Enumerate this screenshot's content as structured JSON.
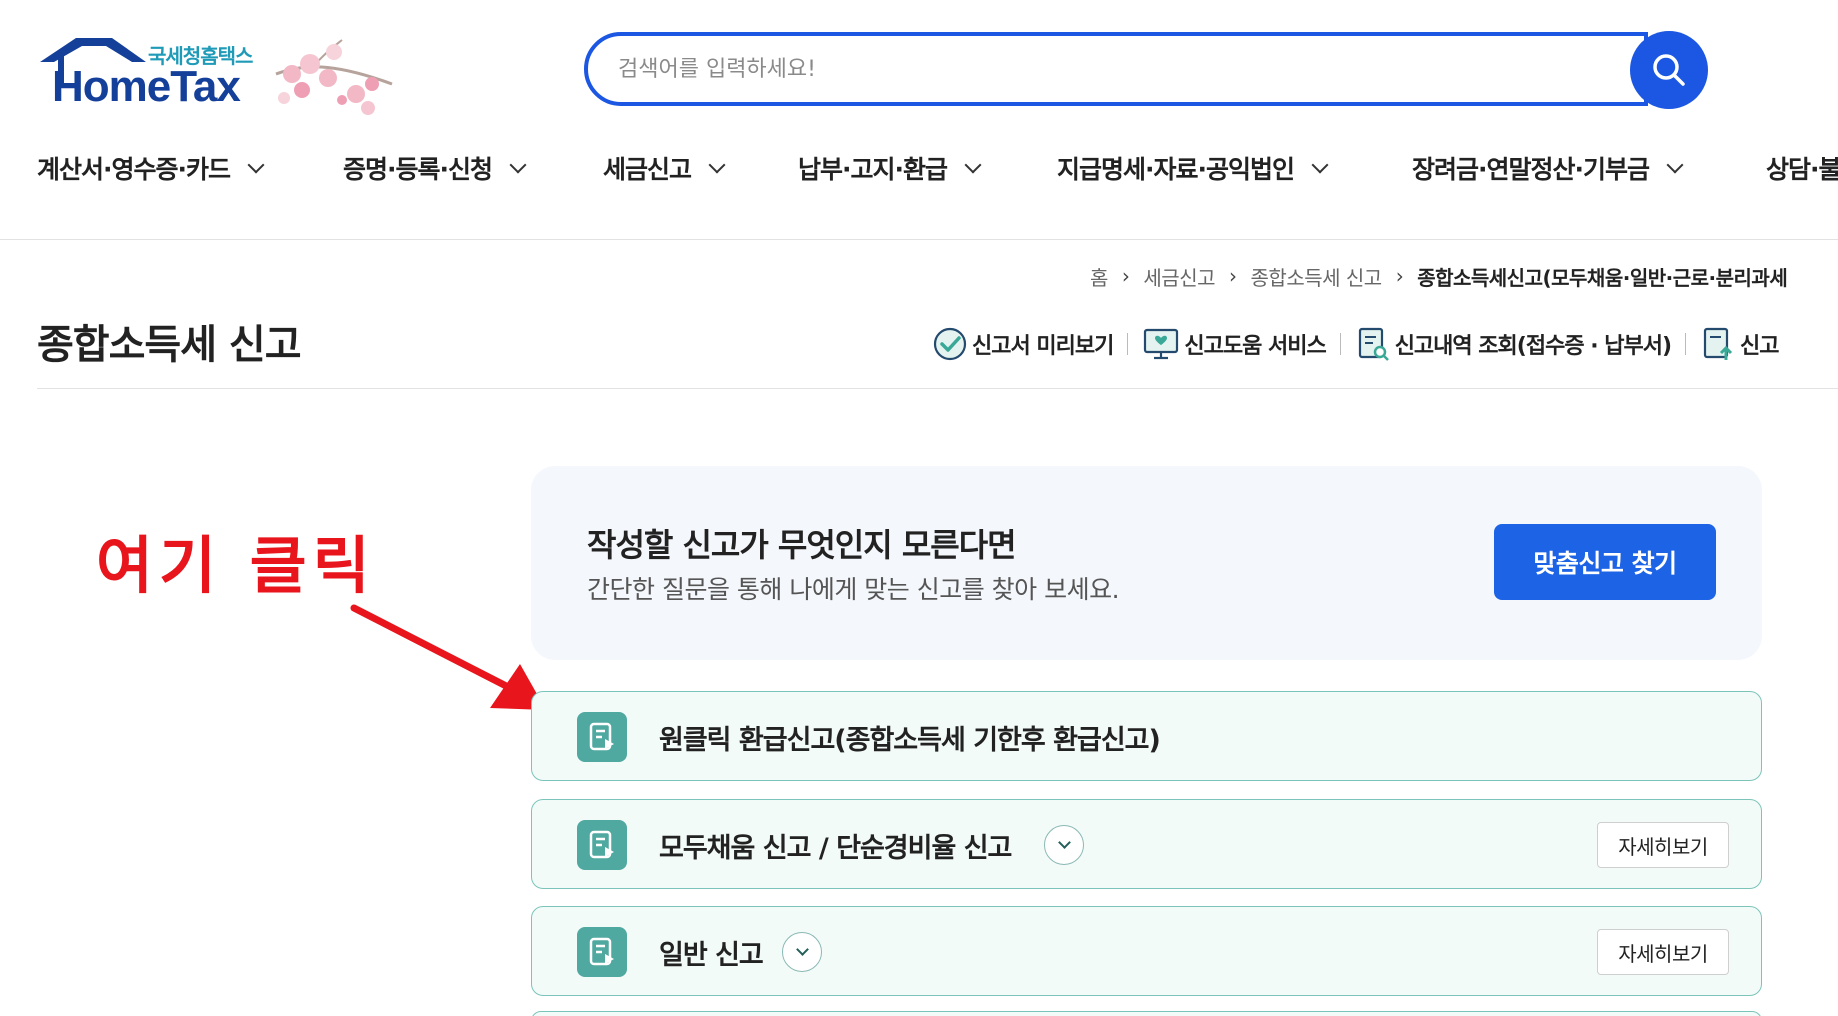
{
  "header": {
    "logo_kr": "국세청홈택스",
    "logo_en": "HomeTax",
    "search_placeholder": "검색어를 입력하세요!"
  },
  "gnb": [
    {
      "label": "계산서·영수증·카드"
    },
    {
      "label": "증명·등록·신청"
    },
    {
      "label": "세금신고"
    },
    {
      "label": "납부·고지·환급"
    },
    {
      "label": "지급명세·자료·공익법인"
    },
    {
      "label": "장려금·연말정산·기부금"
    },
    {
      "label": "상담·불"
    }
  ],
  "breadcrumb": {
    "home": "홈",
    "level1": "세금신고",
    "level2": "종합소득세 신고",
    "current": "종합소득세신고(모두채움·일반·근로·분리과세"
  },
  "page_title": "종합소득세 신고",
  "quick_links": [
    {
      "label": "신고서 미리보기"
    },
    {
      "label": "신고도움 서비스"
    },
    {
      "label": "신고내역 조회(접수증 · 납부서)"
    },
    {
      "label": "신고"
    }
  ],
  "annotation": {
    "text": "여기 클릭",
    "color": "#e8161c"
  },
  "guide": {
    "title": "작성할 신고가 무엇인지 모른다면",
    "desc": "간단한 질문을 통해 나에게 맞는 신고를 찾아 보세요.",
    "button": "맞춤신고 찾기"
  },
  "items": [
    {
      "title": "원클릭 환급신고(종합소득세 기한후 환급신고)"
    },
    {
      "title": "모두채움 신고 / 단순경비율 신고",
      "detail": "자세히보기"
    },
    {
      "title": "일반 신고",
      "detail": "자세히보기"
    }
  ],
  "colors": {
    "primary": "#1b57e2",
    "teal_icon": "#4fa9a0",
    "item_border": "#7cc4b9"
  }
}
